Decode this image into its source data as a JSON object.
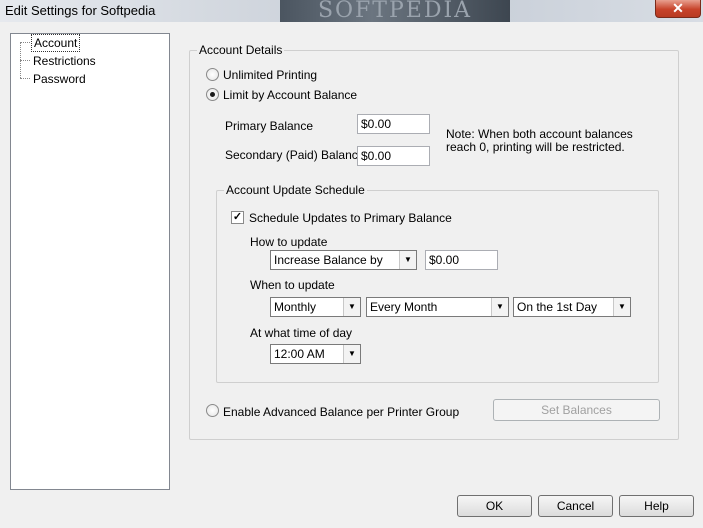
{
  "window": {
    "title": "Edit Settings for Softpedia",
    "watermark": "SOFTPEDIA",
    "close_glyph": "✕"
  },
  "tree": {
    "items": [
      {
        "label": "Account",
        "selected": true
      },
      {
        "label": "Restrictions",
        "selected": false
      },
      {
        "label": "Password",
        "selected": false
      }
    ]
  },
  "account_details": {
    "legend": "Account Details",
    "unlimited_label": "Unlimited Printing",
    "limit_label": "Limit by Account Balance",
    "selected_mode": "limit",
    "primary_balance_label": "Primary Balance",
    "primary_balance_value": "$0.00",
    "secondary_balance_label": "Secondary (Paid) Balance",
    "secondary_balance_value": "$0.00",
    "note_line1": "Note: When both account balances",
    "note_line2": "reach 0, printing will be restricted."
  },
  "schedule": {
    "legend": "Account Update Schedule",
    "checkbox_label": "Schedule Updates to Primary Balance",
    "checked": true,
    "how_label": "How to update",
    "how_value": "Increase Balance by",
    "amount_value": "$0.00",
    "when_label": "When to update",
    "frequency_value": "Monthly",
    "interval_value": "Every Month",
    "day_value": "On the 1st Day",
    "time_label": "At what time of day",
    "time_value": "12:00 AM"
  },
  "advanced": {
    "label": "Enable Advanced Balance per Printer Group",
    "selected": false,
    "set_balances_label": "Set Balances"
  },
  "buttons": {
    "ok": "OK",
    "cancel": "Cancel",
    "help": "Help"
  }
}
